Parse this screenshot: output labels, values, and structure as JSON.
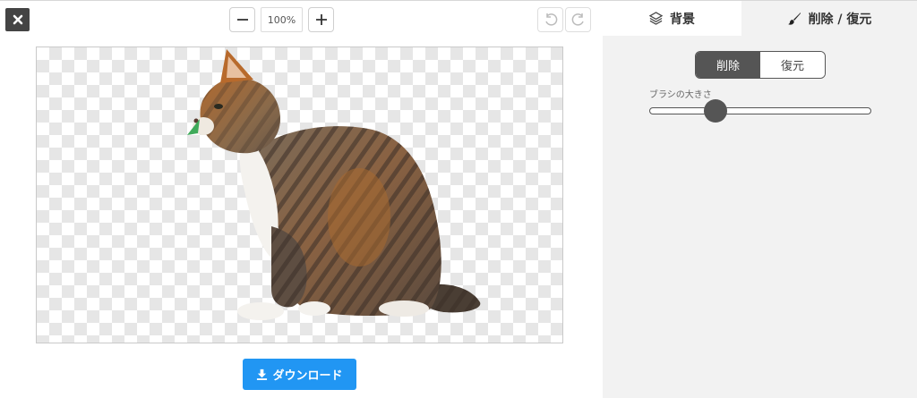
{
  "toolbar": {
    "zoom_level": "100%",
    "zoom_out_icon": "minus-icon",
    "zoom_in_icon": "plus-icon",
    "undo_icon": "undo-icon",
    "redo_icon": "redo-icon",
    "close_icon": "close-icon"
  },
  "tabs": [
    {
      "label": "背景",
      "icon": "layers-icon",
      "active": false
    },
    {
      "label": "削除 / 復元",
      "icon": "brush-icon",
      "active": true
    }
  ],
  "mode": {
    "options": [
      "削除",
      "復元"
    ],
    "selected": "削除"
  },
  "brush": {
    "label": "ブラシの大きさ",
    "value": 0.3
  },
  "download": {
    "label": "ダウンロード",
    "icon": "download-icon",
    "color": "#2196f3"
  }
}
